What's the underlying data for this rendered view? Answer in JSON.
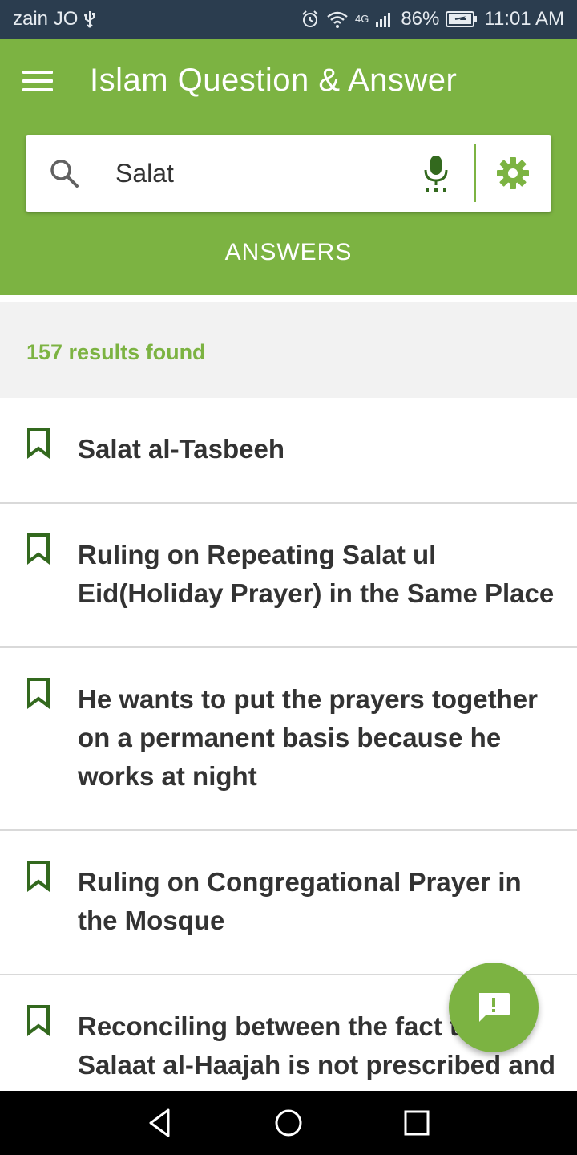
{
  "status_bar": {
    "carrier": "zain JO",
    "network": "4G",
    "battery": "86%",
    "time": "11:01 AM"
  },
  "app_bar": {
    "title": "Islam Question & Answer"
  },
  "search": {
    "value": "Salat",
    "placeholder": ""
  },
  "tabs": [
    {
      "label": "ANSWERS",
      "active": true
    }
  ],
  "results": {
    "count_text": "157 results found",
    "items": [
      {
        "title": "Salat al-Tasbeeh"
      },
      {
        "title": "Ruling on Repeating Salat ul Eid(Holiday Prayer) in the Same Place"
      },
      {
        "title": "He wants to put the prayers together on a permanent basis because he works at night"
      },
      {
        "title": "Ruling on Congregational Prayer in the Mosque"
      },
      {
        "title": "Reconciling between the fact that Salaat al-Haajah is not prescribed and the hadith which states that if..."
      }
    ]
  },
  "colors": {
    "primary": "#7cb342",
    "status_bar": "#2b3d4f",
    "bookmark": "#33691e",
    "text": "#333333"
  },
  "icons": {
    "menu": "hamburger-menu-icon",
    "search": "search-icon",
    "mic": "microphone-icon",
    "settings": "gear-icon",
    "bookmark": "bookmark-outline-icon",
    "fab": "feedback-icon"
  }
}
